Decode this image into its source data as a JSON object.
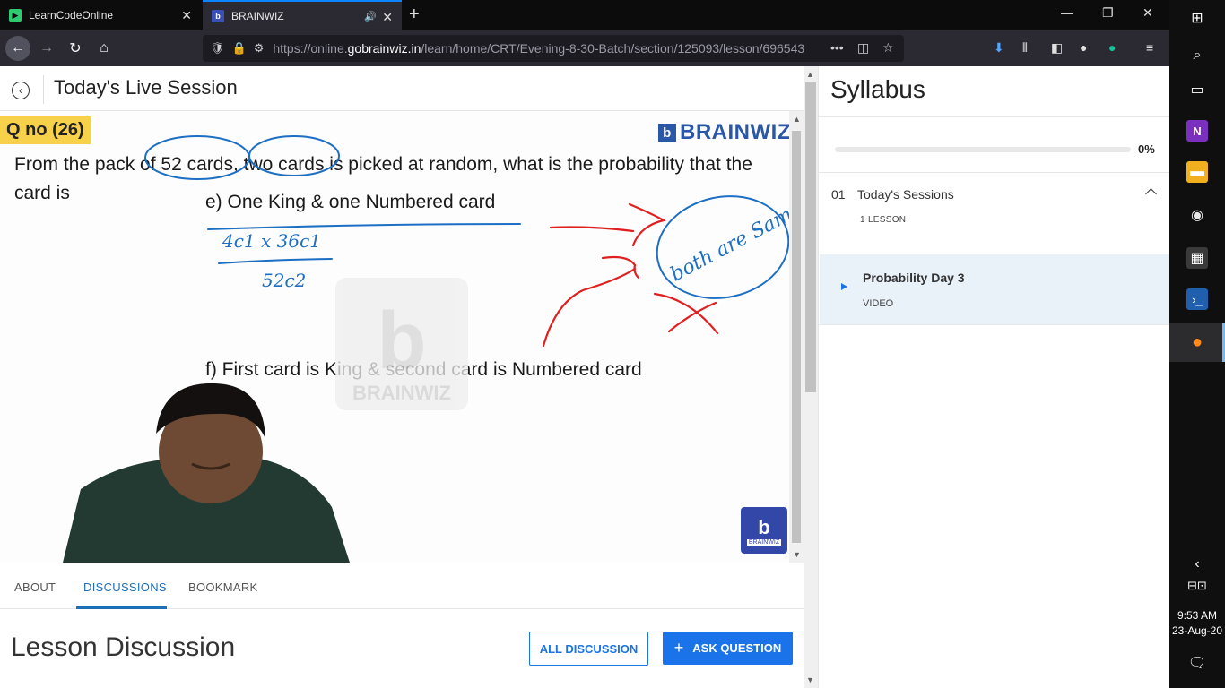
{
  "browser": {
    "tabs": [
      {
        "title": "LearnCodeOnline"
      },
      {
        "title": "BRAINWIZ"
      }
    ],
    "url_prefix": "https://online.",
    "url_domain": "gobrainwiz.in",
    "url_path": "/learn/home/CRT/Evening-8-30-Batch/section/125093/lesson/696543"
  },
  "lesson": {
    "title": "Today's Live Session"
  },
  "video": {
    "q_no": "Q no (26)",
    "brand": "BRAINWIZ",
    "question": "From the pack of 52 cards, two cards is picked at random, what is the probability that the card is",
    "option_e": "e) One King & one Numbered card",
    "option_f": "f) First card is King & second card is Numbered card",
    "handwriting_note": "both are Same",
    "formula_top": "4c1 x 36c1",
    "formula_bottom": "52c2",
    "watermark": "BRAINWIZ",
    "corner_logo": "BRAINWIZ"
  },
  "tabs": [
    {
      "label": "ABOUT"
    },
    {
      "label": "DISCUSSIONS"
    },
    {
      "label": "BOOKMARK"
    }
  ],
  "discussion": {
    "title": "Lesson Discussion",
    "all_label": "ALL DISCUSSION",
    "ask_label": "ASK QUESTION"
  },
  "syllabus": {
    "title": "Syllabus",
    "progress": 0,
    "progress_label": "0%",
    "section_number": "01",
    "section_name": "Today's Sessions",
    "section_count": "1 LESSON",
    "lesson_name": "Probability Day 3",
    "lesson_type": "VIDEO"
  },
  "taskbar": {
    "time": "9:53 AM",
    "date": "23-Aug-20"
  },
  "colors": {
    "accent": "#1a73e8",
    "tab_active": "#1e6fb5",
    "highlight": "#f8d14a",
    "ink_blue": "#1d6fc4",
    "ink_red": "#e02020"
  }
}
